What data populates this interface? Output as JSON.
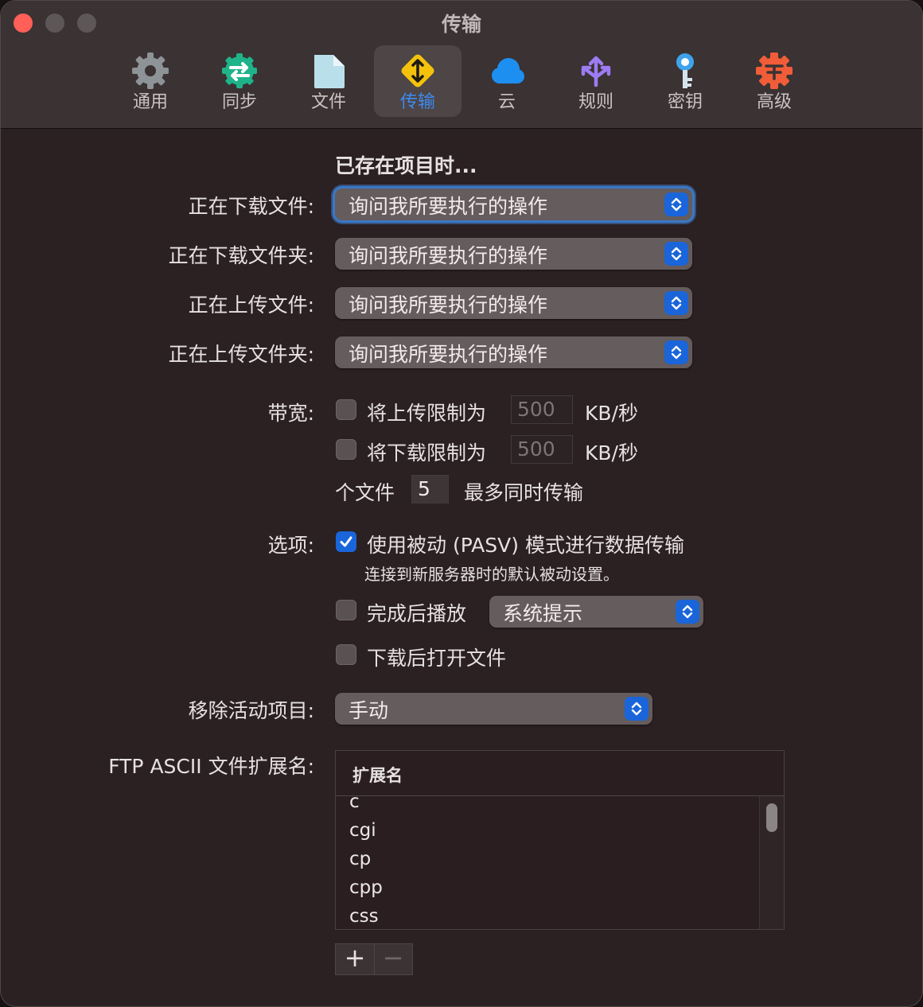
{
  "window": {
    "title": "传输"
  },
  "tabs": [
    {
      "label": "通用",
      "icon": "gear-icon"
    },
    {
      "label": "同步",
      "icon": "sync-icon"
    },
    {
      "label": "文件",
      "icon": "document-icon"
    },
    {
      "label": "传输",
      "icon": "transfer-icon",
      "selected": true
    },
    {
      "label": "云",
      "icon": "cloud-icon"
    },
    {
      "label": "规则",
      "icon": "rules-icon"
    },
    {
      "label": "密钥",
      "icon": "key-icon"
    },
    {
      "label": "高级",
      "icon": "advanced-gear-icon"
    }
  ],
  "existing": {
    "heading": "已存在项目时...",
    "rows": [
      {
        "label": "正在下载文件:",
        "value": "询问我所要执行的操作"
      },
      {
        "label": "正在下载文件夹:",
        "value": "询问我所要执行的操作"
      },
      {
        "label": "正在上传文件:",
        "value": "询问我所要执行的操作"
      },
      {
        "label": "正在上传文件夹:",
        "value": "询问我所要执行的操作"
      }
    ]
  },
  "bandwidth": {
    "label": "带宽:",
    "upload": {
      "label": "将上传限制为",
      "value": "500",
      "unit": "KB/秒",
      "checked": false
    },
    "download": {
      "label": "将下载限制为",
      "value": "500",
      "unit": "KB/秒",
      "checked": false
    },
    "concurrent": {
      "prefix": "个文件",
      "value": "5",
      "suffix": "最多同时传输"
    }
  },
  "options": {
    "label": "选项:",
    "pasv": {
      "label": "使用被动 (PASV) 模式进行数据传输",
      "description": "连接到新服务器时的默认被动设置。",
      "checked": true
    },
    "play_sound": {
      "label": "完成后播放",
      "sound": "系统提示",
      "checked": false
    },
    "open_after": {
      "label": "下载后打开文件",
      "checked": false
    }
  },
  "remove_active": {
    "label": "移除活动项目:",
    "value": "手动"
  },
  "ascii": {
    "label": "FTP ASCII 文件扩展名:",
    "column": "扩展名",
    "items": [
      "c",
      "cgi",
      "cp",
      "cpp",
      "css"
    ],
    "add": "+",
    "remove": "−"
  },
  "colors": {
    "accent": "#1a65d9",
    "selected_tab_text": "#3d8bf2",
    "close_button": "#fe5f57"
  }
}
